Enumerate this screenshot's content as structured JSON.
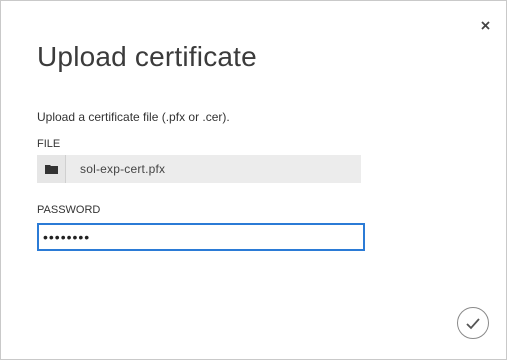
{
  "dialog": {
    "title": "Upload certificate",
    "description": "Upload a certificate file (.pfx or .cer).",
    "close_icon": "close-icon",
    "confirm_icon": "checkmark-icon"
  },
  "file": {
    "label": "FILE",
    "value": "sol-exp-cert.pfx",
    "icon": "folder-icon"
  },
  "password": {
    "label": "PASSWORD",
    "value": "••••••••"
  },
  "colors": {
    "focus_border": "#2b7bd6",
    "title_text": "#3b3b3b",
    "field_background": "#ececec"
  }
}
